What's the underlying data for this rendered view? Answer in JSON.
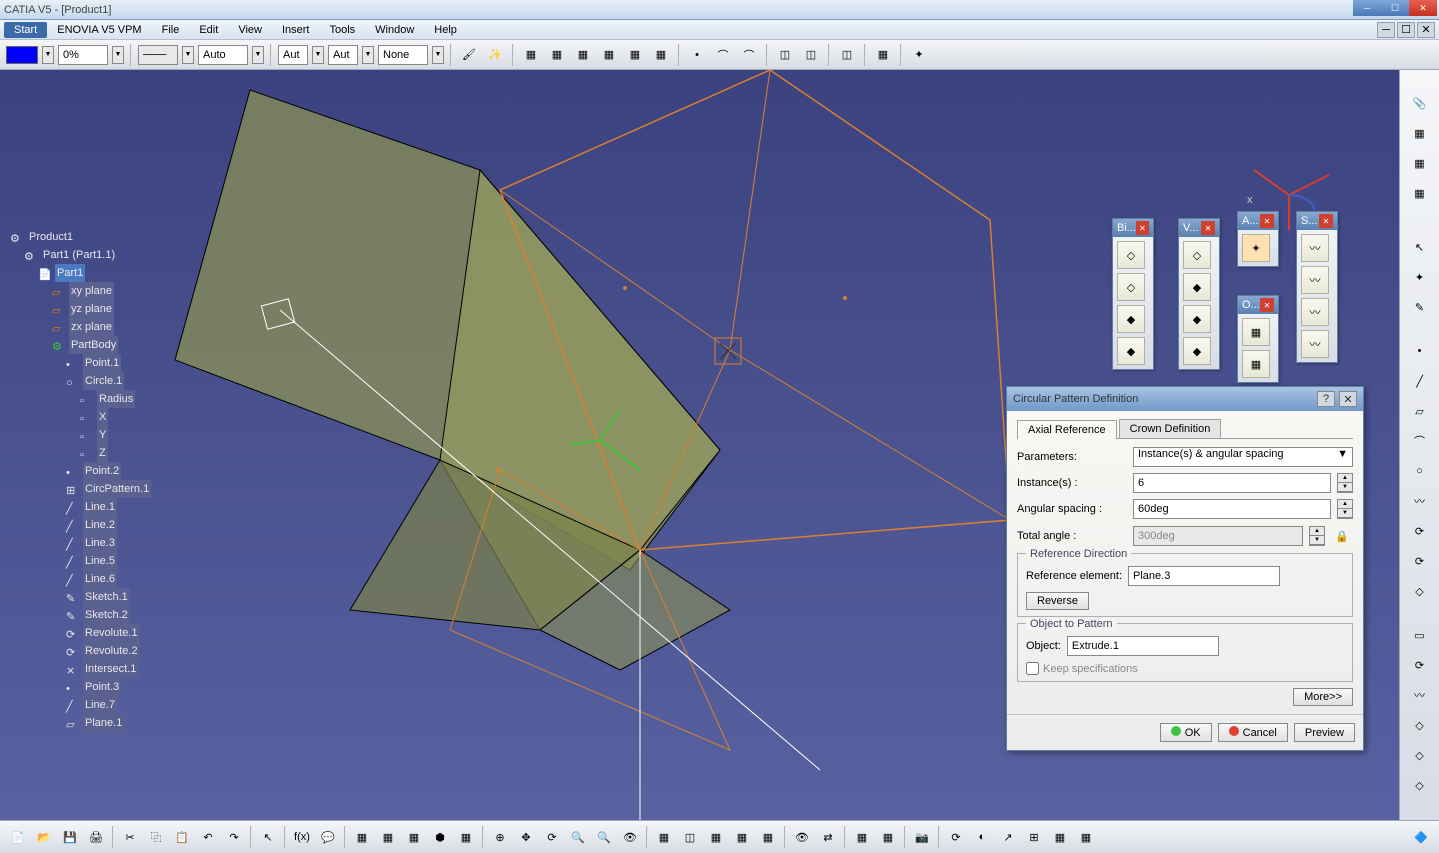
{
  "window": {
    "title": "CATIA V5 - [Product1]"
  },
  "menu": {
    "start": "Start",
    "items": [
      "ENOVIA V5 VPM",
      "File",
      "Edit",
      "View",
      "Insert",
      "Tools",
      "Window",
      "Help"
    ]
  },
  "toolbar": {
    "opacity": "0%",
    "line1": "Auto",
    "line2": "Aut",
    "line3": "Aut",
    "line4": "None"
  },
  "tree": {
    "root": "Product1",
    "part": "Part1 (Part1.1)",
    "part1": "Part1",
    "planes": [
      "xy plane",
      "yz plane",
      "zx plane"
    ],
    "body": "PartBody",
    "items": [
      "Point.1",
      "Circle.1"
    ],
    "circle_children": [
      "Radius",
      "X",
      "Y",
      "Z"
    ],
    "rest": [
      "Point.2",
      "CircPattern.1",
      "Line.1",
      "Line.2",
      "Line.3",
      "Line.5",
      "Line.6",
      "Sketch.1",
      "Sketch.2",
      "Revolute.1",
      "Revolute.2",
      "Intersect.1",
      "Point.3",
      "Line.7",
      "Plane.1"
    ]
  },
  "palettes": {
    "b": "Bi...",
    "v": "V...",
    "a": "A...",
    "o": "O...",
    "s": "S..."
  },
  "dialog": {
    "title": "Circular Pattern Definition",
    "tabs": [
      "Axial Reference",
      "Crown Definition"
    ],
    "params_label": "Parameters:",
    "params_value": "Instance(s) & angular spacing",
    "instances_label": "Instance(s) :",
    "instances_value": "6",
    "spacing_label": "Angular spacing :",
    "spacing_value": "60deg",
    "total_label": "Total angle :",
    "total_value": "300deg",
    "refdir_title": "Reference Direction",
    "refel_label": "Reference element:",
    "refel_value": "Plane.3",
    "reverse": "Reverse",
    "obj_title": "Object to Pattern",
    "obj_label": "Object:",
    "obj_value": "Extrude.1",
    "keep_specs": "Keep specifications",
    "more": "More>>",
    "ok": "OK",
    "cancel": "Cancel",
    "preview": "Preview"
  }
}
